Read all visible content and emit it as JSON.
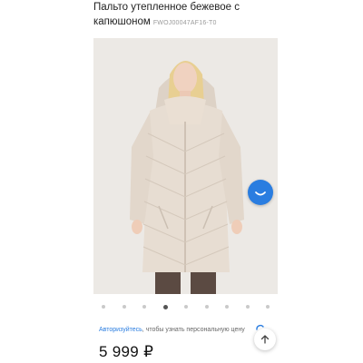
{
  "product": {
    "title": "Пальто утепленное бежевое с капюшоном",
    "sku": "FWOJ00047AF16-T0",
    "price": "5 999 ₽"
  },
  "gallery": {
    "slide_count": 9,
    "active_index": 3
  },
  "auth_prompt": {
    "link": "Авторизуйтесь",
    "text": ", чтобы узнать персональную цену"
  },
  "colors": {
    "accent": "#2a7de0",
    "photo_bg": "#ece9e5",
    "coat": "#e7ddd2"
  },
  "icons": [
    "smile-chat-icon",
    "arrow-up-icon"
  ]
}
